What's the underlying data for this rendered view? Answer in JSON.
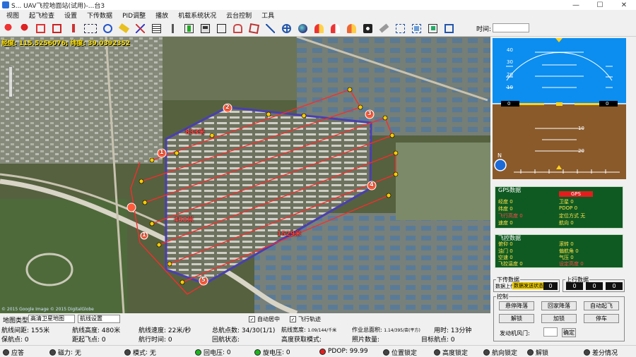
{
  "window": {
    "title": "S... UAV飞控地面站(试用)-...台3"
  },
  "menu": [
    "视图",
    "起飞检查",
    "设置",
    "下传数据",
    "PID调整",
    "播放",
    "机载系统状况",
    "云台控制",
    "工具"
  ],
  "toolbar": {
    "time_label": "时间:",
    "time_value": ""
  },
  "map": {
    "coord_text": "经度: 115.5256076;  纬度: 39.0392352",
    "distance_labels": [
      "833米",
      "1529米",
      "450米"
    ],
    "copyright": "© 2015 Google  Image © 2015 DigitalGlobe",
    "waypoint_numbers": [
      "1",
      "2",
      "3",
      "4",
      "5",
      "1"
    ]
  },
  "map_controls": {
    "map_type_label": "地图类型",
    "map_type_value": "高清卫星地图",
    "second_value": "航线设置",
    "check_autocenter": "自动居中",
    "check_trail": "飞行轨迹"
  },
  "info_rows": {
    "row1": [
      {
        "label": "航线间距",
        "value": "155米"
      },
      {
        "label": "航线高度",
        "value": "480米"
      },
      {
        "label": "航线速度",
        "value": "22米/秒"
      },
      {
        "label": "总航点数",
        "value": "34/30(1/1)"
      },
      {
        "label": "航线宽度",
        "value": "1.09/144/千米"
      },
      {
        "label": "作业总面积",
        "value": "1.14/395/亩(平方)"
      },
      {
        "label": "用时",
        "value": "13分钟"
      }
    ],
    "row2": [
      {
        "label": "保航点",
        "value": "0"
      },
      {
        "label": "距起飞点",
        "value": "0"
      },
      {
        "label": "航行时间",
        "value": "0"
      },
      {
        "label": "回航状态",
        "value": ""
      },
      {
        "label": "高度获取模式",
        "value": ""
      },
      {
        "label": "照片数量",
        "value": ""
      },
      {
        "label": "目标航点",
        "value": "0"
      }
    ]
  },
  "hud": {
    "pitch_marks": [
      "40",
      "30",
      "20",
      "10",
      "10",
      "20"
    ],
    "roll_left": "0",
    "roll_right": "0",
    "compass_n": "N"
  },
  "gps_panel": {
    "title": "GPS数据",
    "badge": "GPS",
    "items": [
      {
        "label": "经度",
        "value": "0",
        "red": false
      },
      {
        "label": "卫星",
        "value": "0",
        "red": false
      },
      {
        "label": "纬度",
        "value": "0",
        "red": false
      },
      {
        "label": "PDOP",
        "value": "0",
        "red": false
      },
      {
        "label": "飞行高度",
        "value": "0",
        "red": true
      },
      {
        "label": "定位方式",
        "value": "无",
        "red": false
      },
      {
        "label": "速度",
        "value": "0",
        "red": false
      },
      {
        "label": "航向",
        "value": "0",
        "red": false
      }
    ]
  },
  "svo_panel": {
    "title": "飞控数据",
    "items": [
      {
        "label": "俯仰",
        "value": "0",
        "red": false
      },
      {
        "label": "滚转",
        "value": "0",
        "red": false
      },
      {
        "label": "油门",
        "value": "0",
        "red": false
      },
      {
        "label": "偏航角",
        "value": "0",
        "red": false
      },
      {
        "label": "空速",
        "value": "0",
        "red": false
      },
      {
        "label": "气压",
        "value": "0",
        "red": false
      },
      {
        "label": "飞控温度",
        "value": "0",
        "red": false
      },
      {
        "label": "设定高度",
        "value": "0",
        "red": true
      }
    ]
  },
  "downlink": {
    "title": "下传数据",
    "label": "数据上传",
    "badge": "数据发送状态",
    "value": "0"
  },
  "uplink": {
    "title": "上行数据",
    "values": [
      "0",
      "0",
      "0"
    ]
  },
  "control": {
    "title": "控制",
    "buttons_row1": [
      "悬停降落",
      "回家降落",
      "自动起飞"
    ],
    "buttons_row2": [
      "解锁",
      "加锁",
      "停车"
    ],
    "throttle_label": "发动机风门:",
    "throttle_value": "",
    "confirm": "确定"
  },
  "status": [
    {
      "label": "应答",
      "value": "",
      "dot": "dark"
    },
    {
      "label": "磁力",
      "value": "无",
      "dot": "dark"
    },
    {
      "label": "模式",
      "value": "无",
      "dot": "dark"
    },
    {
      "label": "回电压",
      "value": "0",
      "dot": "green"
    },
    {
      "label": "旋电压",
      "value": "0",
      "dot": "green"
    },
    {
      "label": "PDOP",
      "value": "99.99",
      "dot": "red"
    },
    {
      "label": "位置锁定",
      "value": "",
      "dot": "dark"
    },
    {
      "label": "高度锁定",
      "value": "",
      "dot": "dark"
    },
    {
      "label": "航向锁定",
      "value": "",
      "dot": "dark"
    },
    {
      "label": "解锁",
      "value": "",
      "dot": "dark"
    },
    {
      "label": "差分情况",
      "value": "",
      "dot": "dark"
    }
  ]
}
